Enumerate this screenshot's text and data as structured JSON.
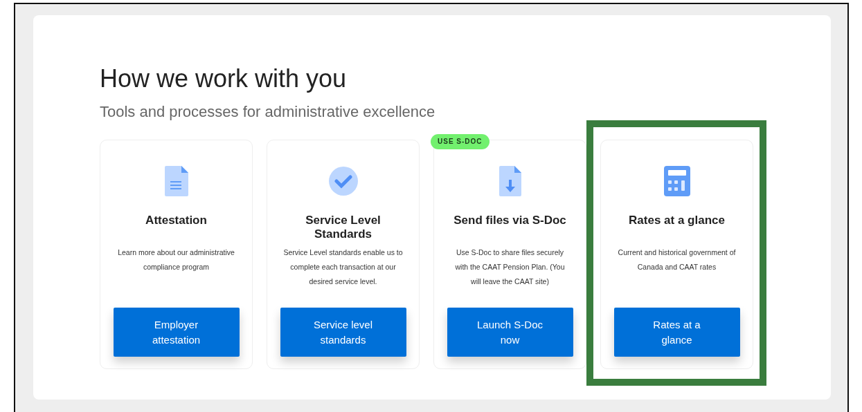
{
  "section": {
    "title": "How we work with you",
    "subtitle": "Tools and processes for administrative excellence"
  },
  "cards": [
    {
      "title": "Attestation",
      "description": "Learn more about our administrative compliance program",
      "button": "Employer attestation",
      "highlighted": false
    },
    {
      "title": "Service Level Standards",
      "description": "Service Level standards enable us to complete each transaction at our desired service level.",
      "button": "Service level standards",
      "highlighted": false
    },
    {
      "badge": "USE S-DOC",
      "title": "Send files via S-Doc",
      "description": "Use S-Doc to share files securely with the CAAT Pension Plan. (You will leave the CAAT site)",
      "button": "Launch S-Doc now",
      "highlighted": false
    },
    {
      "title": "Rates at a glance",
      "description": "Current and historical government of Canada and CAAT rates",
      "button": "Rates at a glance",
      "highlighted": true
    }
  ]
}
